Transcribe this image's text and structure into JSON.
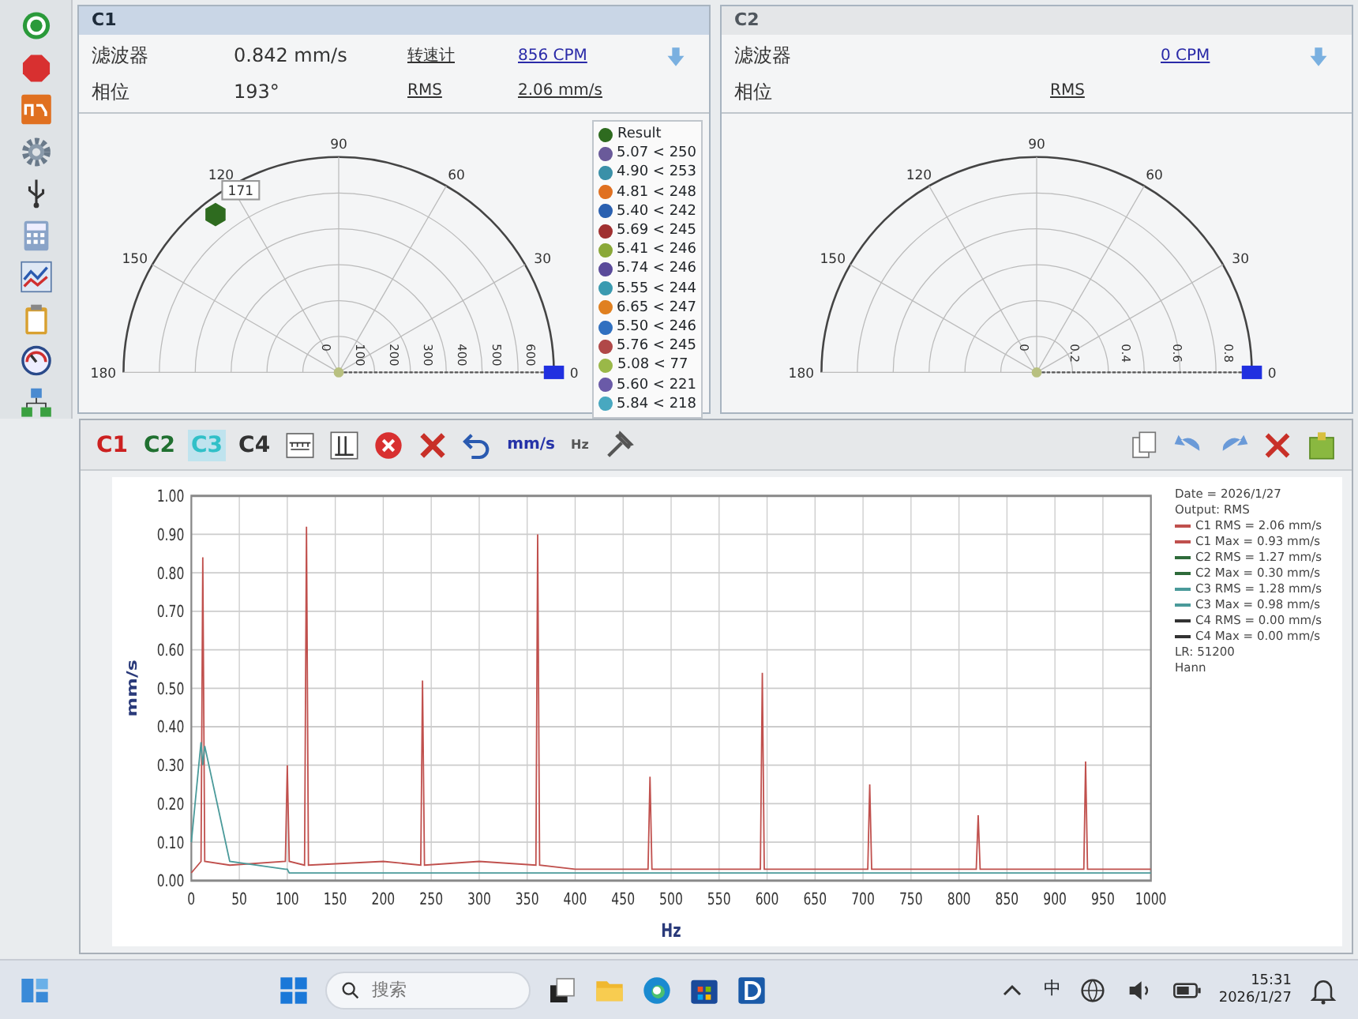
{
  "panels": [
    {
      "title": "C1",
      "selected": true,
      "filter_label": "滤波器",
      "filter_value": "0.842 mm/s",
      "phase_label": "相位",
      "phase_value": "193°",
      "tacho_label": "转速计",
      "tacho_value": "856 CPM",
      "rms_label": "RMS",
      "rms_value": "2.06 mm/s",
      "polar": {
        "angle_labels": [
          "0",
          "30",
          "60",
          "90",
          "120",
          "150",
          "180"
        ],
        "radial_labels": [
          "0",
          "100",
          "200",
          "300",
          "400",
          "500",
          "600"
        ],
        "marker_label": "171",
        "legend": [
          {
            "label": "Result",
            "color": "#2e6b1f"
          },
          {
            "label": "5.07 < 250",
            "color": "#6a5a9a"
          },
          {
            "label": "4.90 < 253",
            "color": "#3a90a8"
          },
          {
            "label": "4.81 < 248",
            "color": "#e07020"
          },
          {
            "label": "5.40 < 242",
            "color": "#2a60b0"
          },
          {
            "label": "5.69 < 245",
            "color": "#a03030"
          },
          {
            "label": "5.41 < 246",
            "color": "#8aa838"
          },
          {
            "label": "5.74 < 246",
            "color": "#5a4a9a"
          },
          {
            "label": "5.55 < 244",
            "color": "#3a9ab0"
          },
          {
            "label": "6.65 < 247",
            "color": "#e08020"
          },
          {
            "label": "5.50 < 246",
            "color": "#3070c0"
          },
          {
            "label": "5.76 < 245",
            "color": "#b04848"
          },
          {
            "label": "5.08 < 77",
            "color": "#9ab848"
          },
          {
            "label": "5.60 < 221",
            "color": "#6a5aa8"
          },
          {
            "label": "5.84 < 218",
            "color": "#48a8c0"
          }
        ]
      }
    },
    {
      "title": "C2",
      "selected": false,
      "filter_label": "滤波器",
      "phase_label": "相位",
      "tacho_value": "0 CPM",
      "rms_label": "RMS",
      "polar": {
        "angle_labels": [
          "0",
          "30",
          "60",
          "90",
          "120",
          "150",
          "180"
        ],
        "radial_labels": [
          "0",
          "0.2",
          "0.4",
          "0.6",
          "0.8"
        ]
      }
    }
  ],
  "toolbar": {
    "channels": [
      {
        "label": "C1",
        "color": "#cc2020",
        "selected": false
      },
      {
        "label": "C2",
        "color": "#207030",
        "selected": false
      },
      {
        "label": "C3",
        "color": "#30c0c8",
        "selected": true
      },
      {
        "label": "C4",
        "color": "#333333",
        "selected": false
      }
    ],
    "unit": "mm/s",
    "freq_unit": "Hz"
  },
  "spectrum": {
    "info_lines": [
      {
        "text": "Date = 2026/1/27"
      },
      {
        "text": "Output: RMS"
      },
      {
        "text": "C1 RMS = 2.06 mm/s",
        "color": "#c0504d"
      },
      {
        "text": "C1 Max = 0.93 mm/s",
        "color": "#c0504d"
      },
      {
        "text": "C2 RMS = 1.27 mm/s",
        "color": "#2e6b3a"
      },
      {
        "text": "C2 Max = 0.30 mm/s",
        "color": "#2e6b3a"
      },
      {
        "text": "C3 RMS = 1.28 mm/s",
        "color": "#4a9a9a"
      },
      {
        "text": "C3 Max = 0.98 mm/s",
        "color": "#4a9a9a"
      },
      {
        "text": "C4 RMS = 0.00 mm/s",
        "color": "#333333"
      },
      {
        "text": "C4 Max = 0.00 mm/s",
        "color": "#333333"
      },
      {
        "text": "LR: 51200"
      },
      {
        "text": "Hann"
      }
    ],
    "chart_data": {
      "type": "line",
      "grid": true,
      "xlabel": "Hz",
      "ylabel": "mm/s",
      "xlim": [
        0,
        1000
      ],
      "ylim": [
        0,
        1
      ],
      "xticks": [
        0,
        50,
        100,
        150,
        200,
        250,
        300,
        350,
        400,
        450,
        500,
        550,
        600,
        650,
        700,
        750,
        800,
        850,
        900,
        950,
        1000
      ],
      "yticks": [
        {
          "value": 0,
          "label": "0.00"
        },
        {
          "value": 0.1,
          "label": "0.10"
        },
        {
          "value": 0.2,
          "label": "0.20"
        },
        {
          "value": 0.3,
          "label": "0.30"
        },
        {
          "value": 0.4,
          "label": "0.40"
        },
        {
          "value": 0.5,
          "label": "0.50"
        },
        {
          "value": 0.6,
          "label": "0.60"
        },
        {
          "value": 0.7,
          "label": "0.70"
        },
        {
          "value": 0.8,
          "label": "0.80"
        },
        {
          "value": 0.9,
          "label": "0.90"
        },
        {
          "value": 1.0,
          "label": "1.00"
        }
      ],
      "x": [
        0,
        10,
        12,
        14,
        40,
        98,
        100,
        102,
        118,
        120,
        122,
        200,
        239,
        241,
        243,
        300,
        359,
        361,
        363,
        400,
        476,
        478,
        480,
        550,
        593,
        595,
        597,
        650,
        705,
        707,
        709,
        780,
        818,
        820,
        822,
        900,
        930,
        932,
        934,
        1000
      ],
      "series": [
        {
          "color": "#c0504d",
          "values": [
            0.02,
            0.05,
            0.84,
            0.05,
            0.04,
            0.05,
            0.3,
            0.05,
            0.04,
            0.92,
            0.04,
            0.05,
            0.04,
            0.52,
            0.04,
            0.05,
            0.04,
            0.9,
            0.04,
            0.03,
            0.03,
            0.27,
            0.03,
            0.03,
            0.03,
            0.54,
            0.03,
            0.03,
            0.03,
            0.25,
            0.03,
            0.03,
            0.03,
            0.17,
            0.03,
            0.03,
            0.03,
            0.31,
            0.03,
            0.03
          ]
        },
        {
          "color": "#4a9a9a",
          "values": [
            0.1,
            0.36,
            0.3,
            0.35,
            0.05,
            0.03,
            0.03,
            0.02,
            0.02,
            0.02,
            0.02,
            0.02,
            0.02,
            0.02,
            0.02,
            0.02,
            0.02,
            0.02,
            0.02,
            0.02,
            0.02,
            0.02,
            0.02,
            0.02,
            0.02,
            0.02,
            0.02,
            0.02,
            0.02,
            0.02,
            0.02,
            0.02,
            0.02,
            0.02,
            0.02,
            0.02,
            0.02,
            0.02,
            0.02,
            0.02
          ]
        }
      ]
    }
  },
  "taskbar": {
    "search_placeholder": "搜索",
    "ime": "中",
    "time": "15:31",
    "date": "2026/1/27"
  }
}
